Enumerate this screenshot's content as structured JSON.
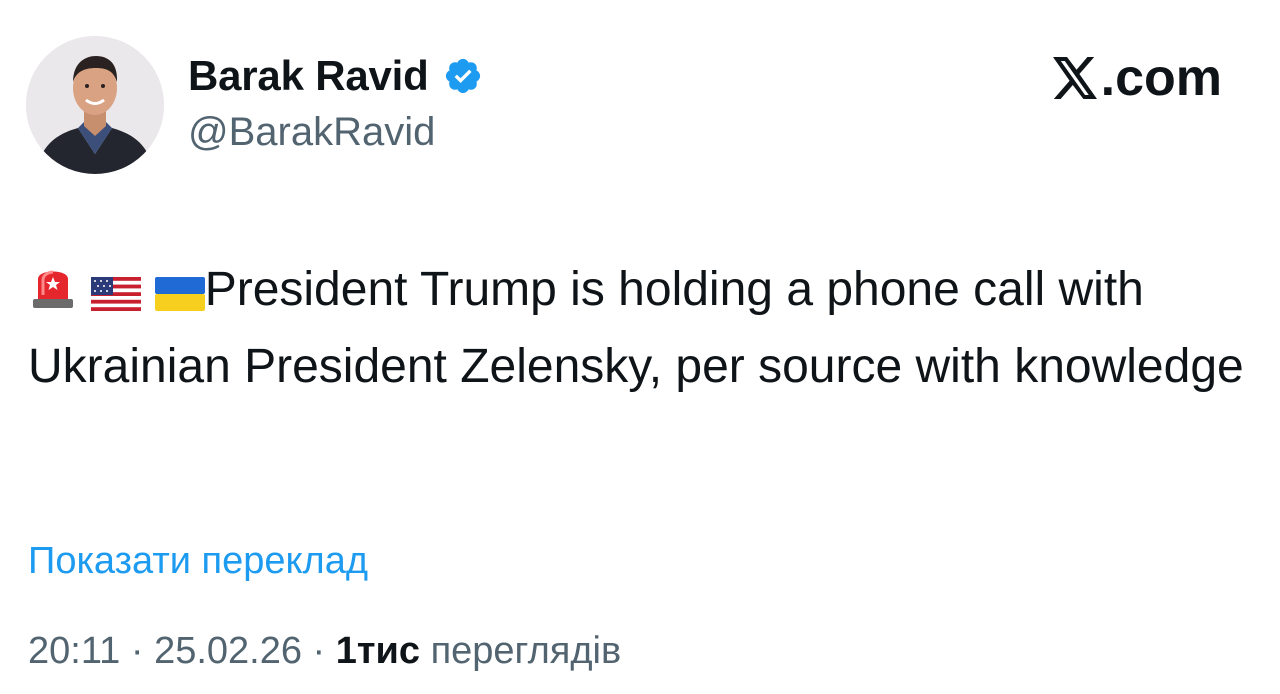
{
  "author": {
    "name": "Barak Ravid",
    "handle": "@BarakRavid",
    "verified": true,
    "avatar": "profile-photo"
  },
  "brand": {
    "label": ".com",
    "logo": "x-logo-icon"
  },
  "tweet": {
    "emojis": [
      "police-light-icon",
      "us-flag-icon",
      "ukraine-flag-icon"
    ],
    "text": "President Trump is holding a phone call with Ukrainian President Zelensky, per source with knowledge"
  },
  "translate_label": "Показати переклад",
  "meta": {
    "time": "20:11",
    "separator": "·",
    "date": "25.02.26",
    "views_count": "1тис",
    "views_label": "переглядів"
  },
  "colors": {
    "link": "#1d9bf0",
    "secondary_text": "#536471",
    "verified_badge": "#1d9bf0"
  }
}
